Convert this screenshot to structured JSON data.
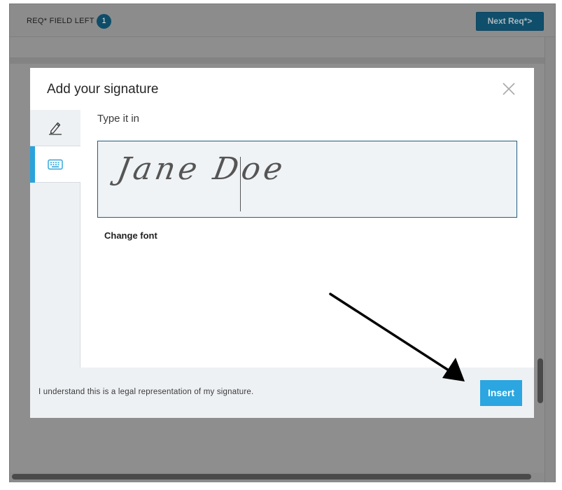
{
  "topbar": {
    "req_label": "REQ* FIELD LEFT",
    "req_count": "1",
    "next_button": "Next Req*>"
  },
  "modal": {
    "title": "Add your signature",
    "tabs": [
      {
        "name": "draw",
        "icon": "pencil-icon"
      },
      {
        "name": "type",
        "icon": "keyboard-icon",
        "active": true
      }
    ],
    "section_title": "Type it in",
    "signature_value": "Jane Doe",
    "change_font_label": "Change font",
    "legal_text": "I understand this is a legal representation of my signature.",
    "insert_label": "Insert"
  },
  "colors": {
    "accent": "#2aa3dc",
    "insert_button": "#2ba6e0",
    "signature_border": "#1e5f7e",
    "overlay": "#8e8e8e"
  }
}
